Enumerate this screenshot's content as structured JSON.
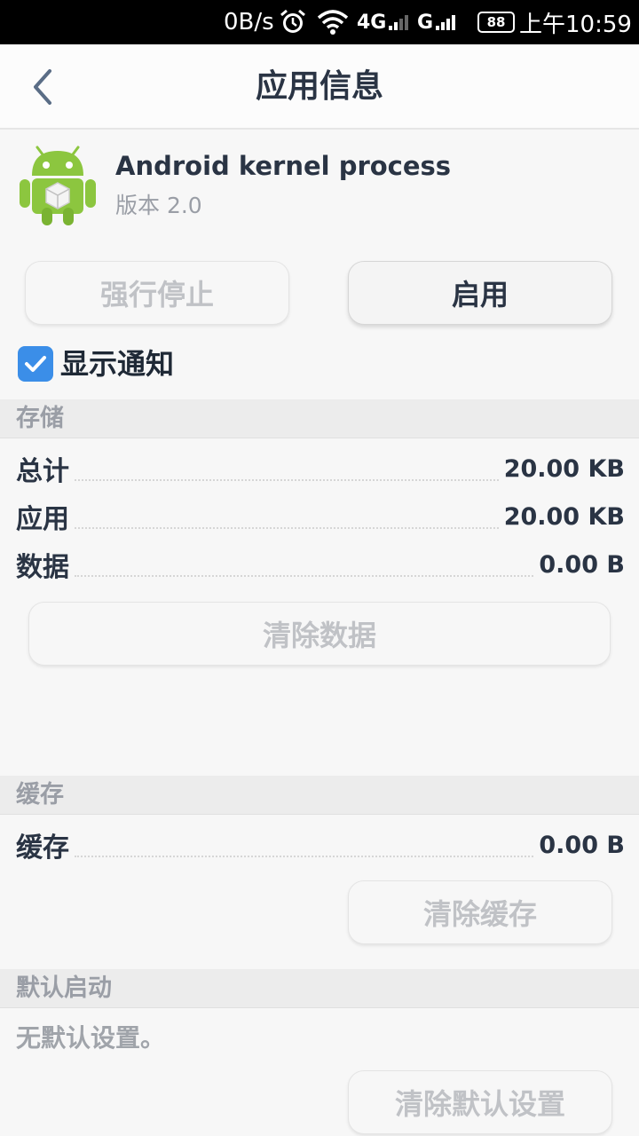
{
  "status_bar": {
    "speed": "0B/s",
    "network_4g": "4G",
    "network_g": "G",
    "battery": "88",
    "time": "上午10:59",
    "icons": [
      "alarm-icon",
      "wifi-icon",
      "signal-icon"
    ]
  },
  "header": {
    "title": "应用信息",
    "back_icon": "chevron-left-icon"
  },
  "app": {
    "name": "Android kernel process",
    "version": "版本 2.0",
    "icon": "android-icon"
  },
  "actions": {
    "force_stop": "强行停止",
    "enable": "启用"
  },
  "notification": {
    "label": "显示通知",
    "checked": true
  },
  "storage": {
    "header": "存储",
    "rows": [
      {
        "label": "总计",
        "value": "20.00 KB"
      },
      {
        "label": "应用",
        "value": "20.00 KB"
      },
      {
        "label": "数据",
        "value": "0.00 B"
      }
    ],
    "clear_data": "清除数据"
  },
  "cache": {
    "header": "缓存",
    "label": "缓存",
    "value": "0.00 B",
    "clear_cache": "清除缓存"
  },
  "default_launch": {
    "header": "默认启动",
    "text": "无默认设置。",
    "clear_defaults": "清除默认设置"
  },
  "colors": {
    "accent": "#3b8ee8",
    "title_text": "#2a3444",
    "disabled_text": "#c0c2c6",
    "android_green": "#8cc63f"
  }
}
